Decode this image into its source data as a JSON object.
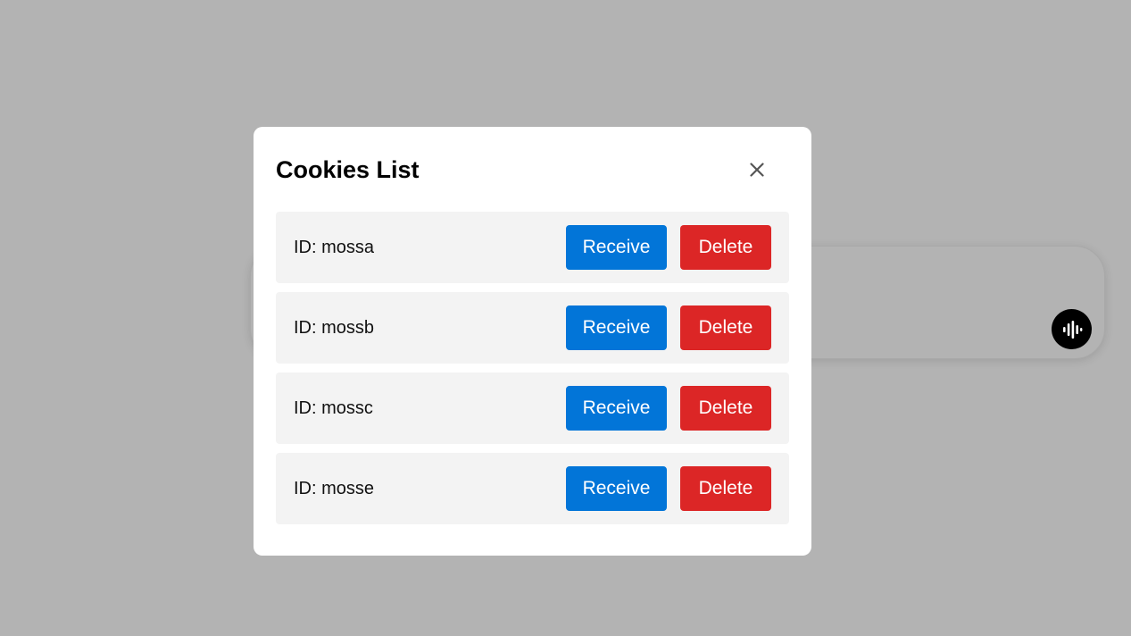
{
  "modal": {
    "title": "Cookies List",
    "close_icon": "close-icon",
    "cookies": [
      {
        "id_label": "ID: mossa",
        "receive_label": "Receive",
        "delete_label": "Delete"
      },
      {
        "id_label": "ID: mossb",
        "receive_label": "Receive",
        "delete_label": "Delete"
      },
      {
        "id_label": "ID: mossc",
        "receive_label": "Receive",
        "delete_label": "Delete"
      },
      {
        "id_label": "ID: mosse",
        "receive_label": "Receive",
        "delete_label": "Delete"
      }
    ]
  },
  "background": {
    "voice_icon": "audio-waveform-icon"
  },
  "colors": {
    "overlay": "#b3b3b3",
    "receive": "#0275d8",
    "delete": "#dc2626",
    "row_bg": "#f3f3f3"
  }
}
